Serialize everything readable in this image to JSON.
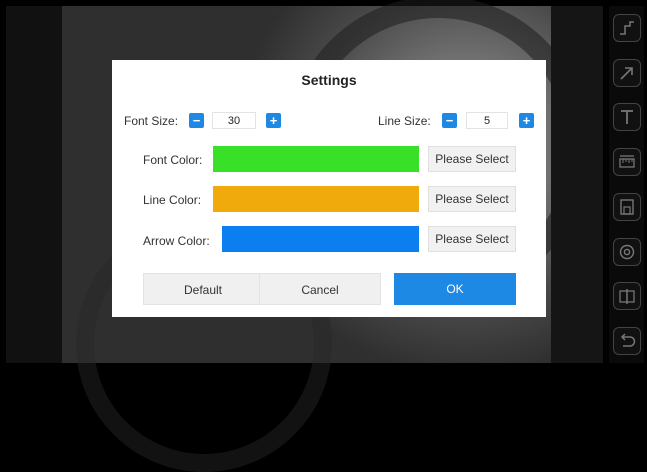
{
  "dialog": {
    "title": "Settings",
    "font_size": {
      "label": "Font Size:",
      "value": "30",
      "minus": "−",
      "plus": "+"
    },
    "line_size": {
      "label": "Line Size:",
      "value": "5",
      "minus": "−",
      "plus": "+"
    },
    "font_color": {
      "label": "Font Color:",
      "color": "#39e028",
      "button": "Please Select"
    },
    "line_color": {
      "label": "Line Color:",
      "color": "#f1aa0b",
      "button": "Please Select"
    },
    "arrow_color": {
      "label": "Arrow Color:",
      "color": "#0b7ef0",
      "button": "Please Select"
    },
    "buttons": {
      "default": "Default",
      "cancel": "Cancel",
      "ok": "OK"
    }
  },
  "toolbar": {
    "tools": [
      "line-chart-icon",
      "arrow-icon",
      "text-icon",
      "ruler-icon",
      "save-icon",
      "settings-icon",
      "split-view-icon",
      "undo-icon"
    ]
  },
  "colors": {
    "accent": "#1e88e5"
  }
}
